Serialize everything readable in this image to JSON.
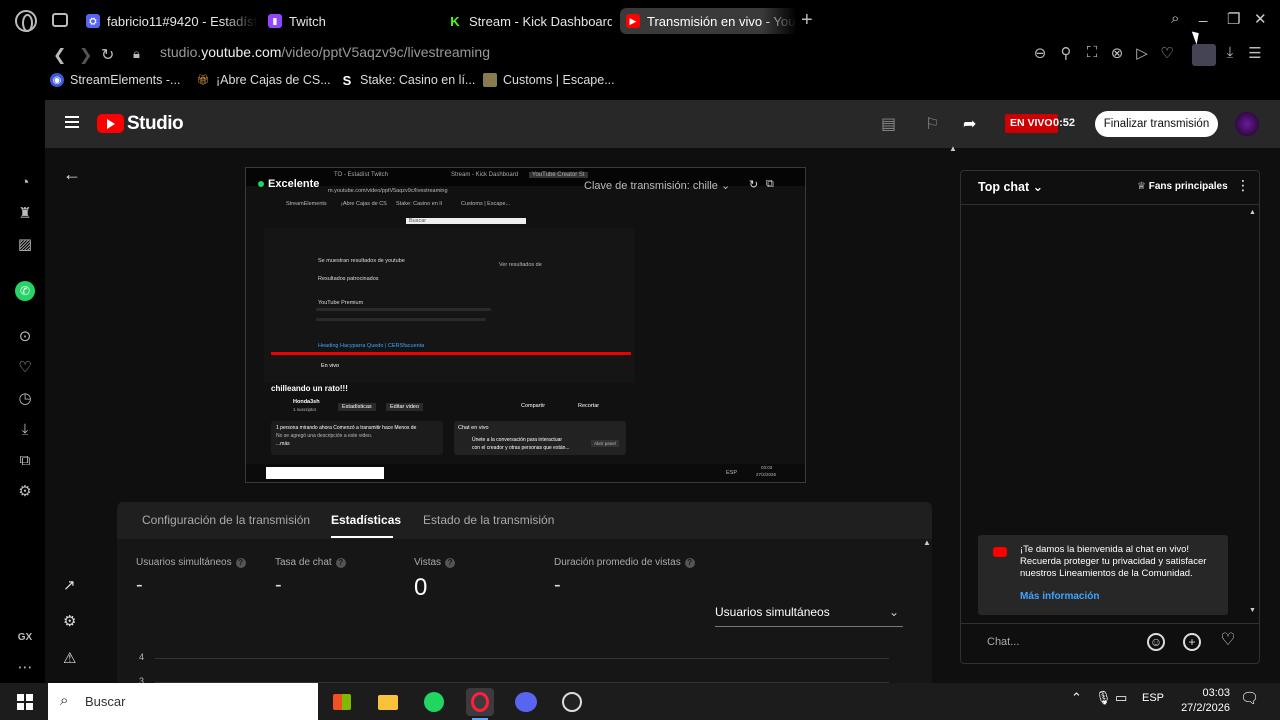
{
  "browser": {
    "tabs": [
      {
        "label": "fabricio11#9420 - Estadíst",
        "icon": "discord-stats-icon",
        "color": "#5865f2"
      },
      {
        "label": "Twitch",
        "icon": "twitch-icon",
        "color": "#9146ff"
      },
      {
        "label": "Stream - Kick Dashboard",
        "icon": "kick-icon",
        "color": "#53fc18"
      },
      {
        "label": "Transmisión en vivo - YouT",
        "icon": "youtube-icon",
        "color": "#ff0000",
        "active": true
      }
    ],
    "new_tab": "+",
    "url_prefix": "studio.",
    "url_domain": "youtube.com",
    "url_path": "/video/pptV5aqzv9c/livestreaming",
    "bookmarks": [
      {
        "label": "StreamElements -...",
        "icon": "streamelements-icon"
      },
      {
        "label": "¡Abre Cajas de CS...",
        "icon": "gift-icon"
      },
      {
        "label": "Stake: Casino en lí...",
        "icon": "stake-icon"
      },
      {
        "label": "Customs | Escape...",
        "icon": "customs-icon"
      }
    ]
  },
  "studio": {
    "logo_text": "Studio",
    "live_badge": "EN VIVO",
    "live_time": "0:52",
    "end_button": "Finalizar transmisión",
    "preview": {
      "quality": "Excelente",
      "stream_key_label": "Clave de transmisión: chille",
      "inner_title": "chilleando un rato!!!",
      "inner_channel": "Honda3sh",
      "inner_subs": "1 suscriptor",
      "inner_buttons": [
        "Estadísticas",
        "Editar video",
        "Compartir",
        "Recortar"
      ],
      "inner_desc": "1 persona mirando ahora  Comenzó a transmitir hace Menos de",
      "inner_desc2": "No se agregó una descripción a este video.",
      "inner_more": "...más",
      "inner_chat_title": "Chat en vivo",
      "inner_chat_msg": "Únete a la conversación para interactuar",
      "inner_chat_msg2": "con el creador y otras personas que están...",
      "inner_chat_btn": "Abrir panel",
      "inner_search": "Buscar",
      "inner_live": "En vivo",
      "inner_sponsored": "Resultados patrocinados",
      "inner_results": "Se muestran resultados de youtube",
      "inner_premium": "YouTube Premium",
      "inner_ad_title": "Heading Hacyparra Quedo | CERSfacuenta",
      "inner_lang": "ESP",
      "inner_time": "03:03",
      "inner_date": "27/2/2026",
      "inner_tabs": [
        "TO - Estadíst",
        "Twitch",
        "Stream - Kick Dashboard",
        "YouTube Creator St"
      ],
      "inner_url": "m.youtube.com/video/pptV5aqzv9c/livestreaming",
      "inner_bookmarks": [
        "StreamElements",
        "¡Abre Cajas de CS",
        "Stake: Casino en lí",
        "Customs | Escape..."
      ],
      "inner_view_results": "Ver resultados de"
    },
    "tabs": [
      {
        "label": "Configuración de la transmisión"
      },
      {
        "label": "Estadísticas",
        "active": true
      },
      {
        "label": "Estado de la transmisión"
      }
    ],
    "stats": [
      {
        "label": "Usuarios simultáneos",
        "value": "-"
      },
      {
        "label": "Tasa de chat",
        "value": "-"
      },
      {
        "label": "Vistas",
        "value": "0"
      },
      {
        "label": "Duración promedio de vistas",
        "value": "-"
      }
    ],
    "help_glyph": "?",
    "metric_select": "Usuarios simultáneos",
    "chart_ticks": [
      "4",
      "3"
    ],
    "chat": {
      "title": "Top chat",
      "fans_button": "Fans principales",
      "welcome": "¡Te damos la bienvenida al chat en vivo! Recuerda proteger tu privacidad y satisfacer nuestros Lineamientos de la Comunidad.",
      "more_info": "Más información",
      "input_placeholder": "Chat..."
    },
    "side_label": "GX"
  },
  "taskbar": {
    "search_placeholder": "Buscar",
    "apps": [
      "store-icon",
      "file-explorer-icon",
      "spotify-icon",
      "opera-gx-icon",
      "discord-icon",
      "obs-icon"
    ],
    "language": "ESP",
    "time": "03:03",
    "date": "27/2/2026"
  }
}
